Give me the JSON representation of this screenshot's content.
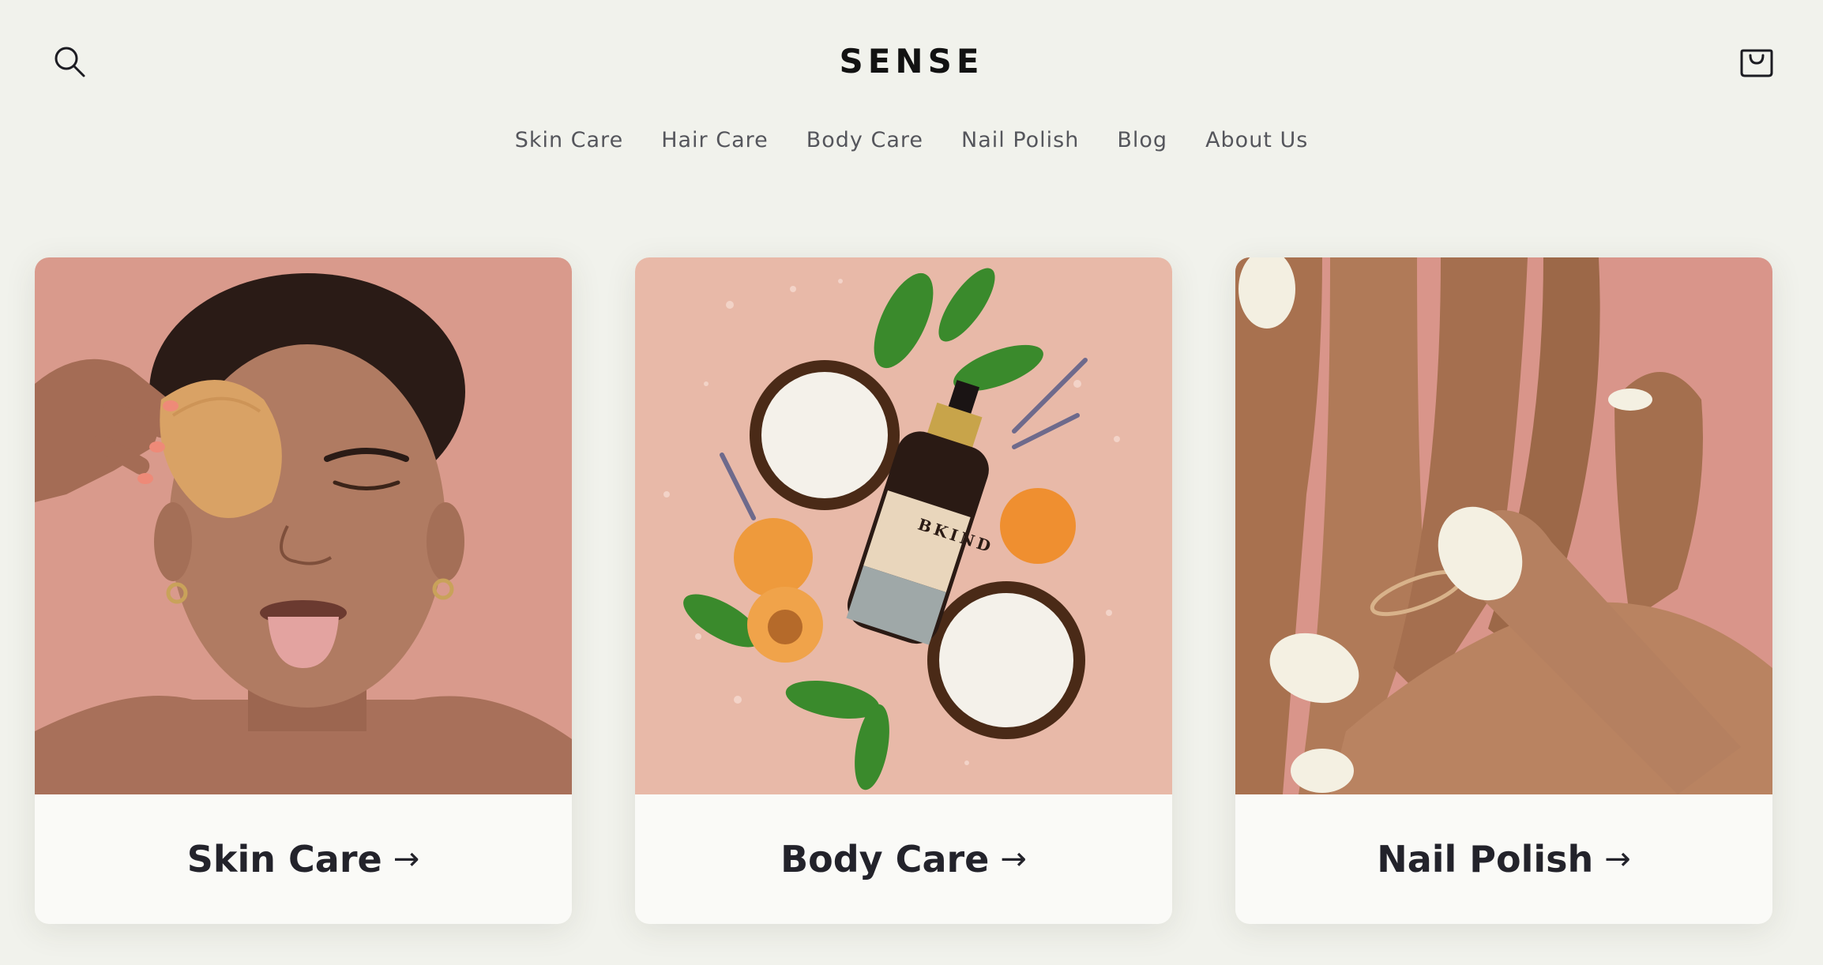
{
  "brand": {
    "name": "SENSE"
  },
  "nav": {
    "items": [
      "Skin Care",
      "Hair Care",
      "Body Care",
      "Nail Polish",
      "Blog",
      "About Us"
    ]
  },
  "icons": {
    "search": "search-icon",
    "cart": "cart-icon",
    "arrow": "arrow-right-icon"
  },
  "colors": {
    "background": "#f1f2ec",
    "card": "#fafaf7",
    "text": "#23232b",
    "nav_text": "#55565c",
    "image_bg_pink": "#d99a8c"
  },
  "collections": [
    {
      "title": "Skin Care",
      "arrow": "→"
    },
    {
      "title": "Body Care",
      "arrow": "→"
    },
    {
      "title": "Nail Polish",
      "arrow": "→"
    }
  ]
}
